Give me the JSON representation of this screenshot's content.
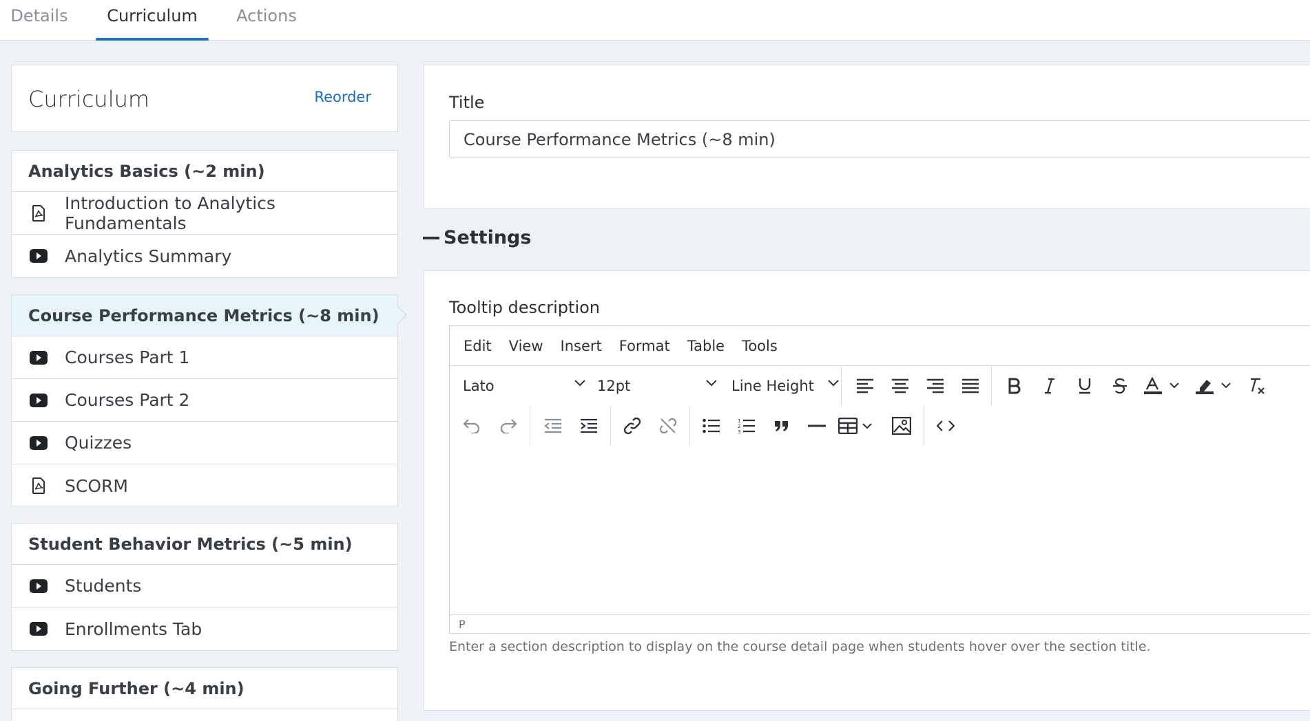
{
  "tabs": [
    {
      "label": "Details",
      "active": false
    },
    {
      "label": "Curriculum",
      "active": true
    },
    {
      "label": "Actions",
      "active": false
    }
  ],
  "curriculum": {
    "title": "Curriculum",
    "reorder_label": "Reorder",
    "sections": [
      {
        "title": "Analytics Basics (~2 min)",
        "active": false,
        "lessons": [
          {
            "label": "Introduction to Analytics Fundamentals",
            "icon": "pdf-icon"
          },
          {
            "label": "Analytics Summary",
            "icon": "video-icon"
          }
        ]
      },
      {
        "title": "Course Performance Metrics (~8 min)",
        "active": true,
        "lessons": [
          {
            "label": "Courses Part 1",
            "icon": "video-icon"
          },
          {
            "label": "Courses Part 2",
            "icon": "video-icon"
          },
          {
            "label": "Quizzes",
            "icon": "video-icon"
          },
          {
            "label": "SCORM",
            "icon": "pdf-icon"
          }
        ]
      },
      {
        "title": "Student Behavior Metrics (~5 min)",
        "active": false,
        "lessons": [
          {
            "label": "Students",
            "icon": "video-icon"
          },
          {
            "label": "Enrollments Tab",
            "icon": "video-icon"
          }
        ]
      },
      {
        "title": "Going Further (~4 min)",
        "active": false,
        "lessons": []
      }
    ]
  },
  "form": {
    "title_label": "Title",
    "title_value": "Course Performance Metrics (~8 min)",
    "settings_label": "Settings",
    "tooltip_label": "Tooltip description",
    "help_text": "Enter a section description to display on the course detail page when students hover over the section title."
  },
  "editor": {
    "menu": [
      "Edit",
      "View",
      "Insert",
      "Format",
      "Table",
      "Tools"
    ],
    "font_family": "Lato",
    "font_size": "12pt",
    "line_height": "Line Height",
    "status_path": "P"
  },
  "colors": {
    "accent": "#1a73c9",
    "link": "#1a6fc1",
    "active_section_bg": "#e8f4fc",
    "page_bg": "#eef1f5"
  }
}
